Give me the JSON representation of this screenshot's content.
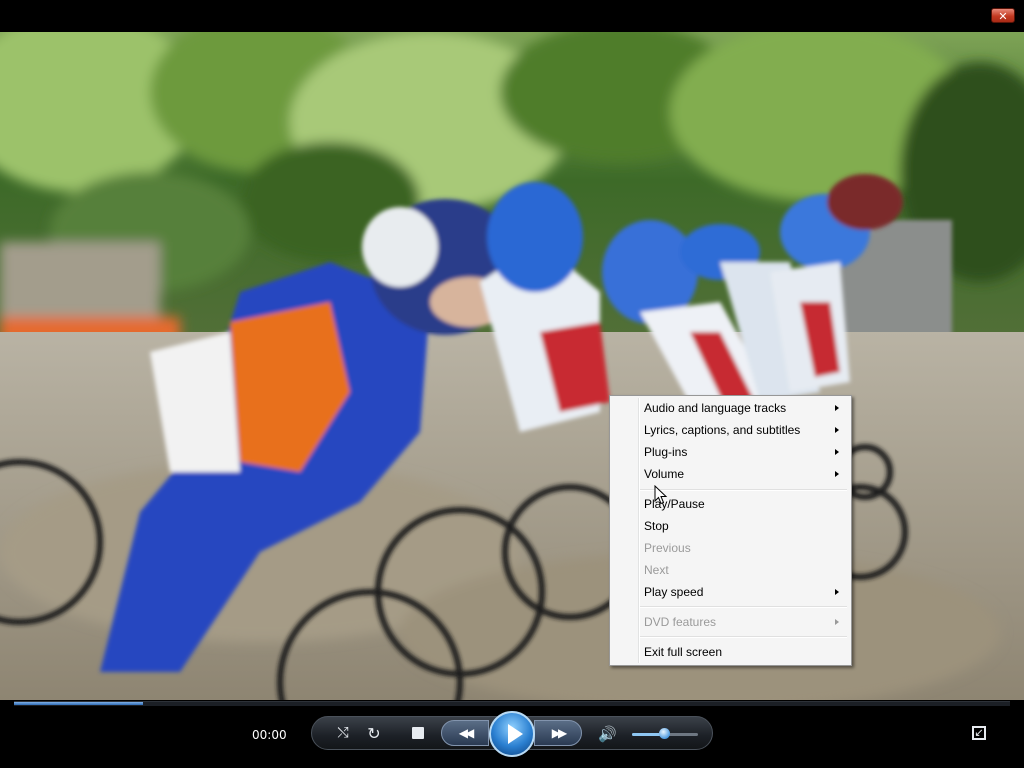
{
  "window": {
    "close_label": "✕"
  },
  "video": {
    "scene": "BMX race start with riders in blue/white/orange gear",
    "progress_fraction": 0.13
  },
  "controls": {
    "time": "00:00",
    "shuffle_icon": "shuffle-icon",
    "repeat_icon": "repeat-icon",
    "stop_icon": "stop-icon",
    "prev_icon": "previous-icon",
    "play_icon": "play-icon",
    "next_icon": "next-icon",
    "volume_icon": "speaker-icon",
    "volume_level": 0.48,
    "exit_fullscreen_icon": "exit-fullscreen-icon",
    "shuffle_glyph": "⤭",
    "repeat_glyph": "↻",
    "prev_glyph": "◀◀",
    "next_glyph": "▶▶",
    "volume_glyph": "🔊",
    "exit_glyph": "↙"
  },
  "context_menu": {
    "items": [
      {
        "label": "Audio and language tracks",
        "submenu": true,
        "enabled": true
      },
      {
        "label": "Lyrics, captions, and subtitles",
        "submenu": true,
        "enabled": true
      },
      {
        "label": "Plug-ins",
        "submenu": true,
        "enabled": true
      },
      {
        "label": "Volume",
        "submenu": true,
        "enabled": true
      },
      {
        "label": "Play/Pause",
        "submenu": false,
        "enabled": true
      },
      {
        "label": "Stop",
        "submenu": false,
        "enabled": true
      },
      {
        "label": "Previous",
        "submenu": false,
        "enabled": false
      },
      {
        "label": "Next",
        "submenu": false,
        "enabled": false
      },
      {
        "label": "Play speed",
        "submenu": true,
        "enabled": true
      },
      {
        "label": "DVD features",
        "submenu": true,
        "enabled": false
      },
      {
        "label": "Exit full screen",
        "submenu": false,
        "enabled": true
      }
    ]
  },
  "colors": {
    "accent": "#2a7fd0",
    "menu_bg": "#f5f5f5",
    "disabled_text": "#9a9a9a"
  }
}
